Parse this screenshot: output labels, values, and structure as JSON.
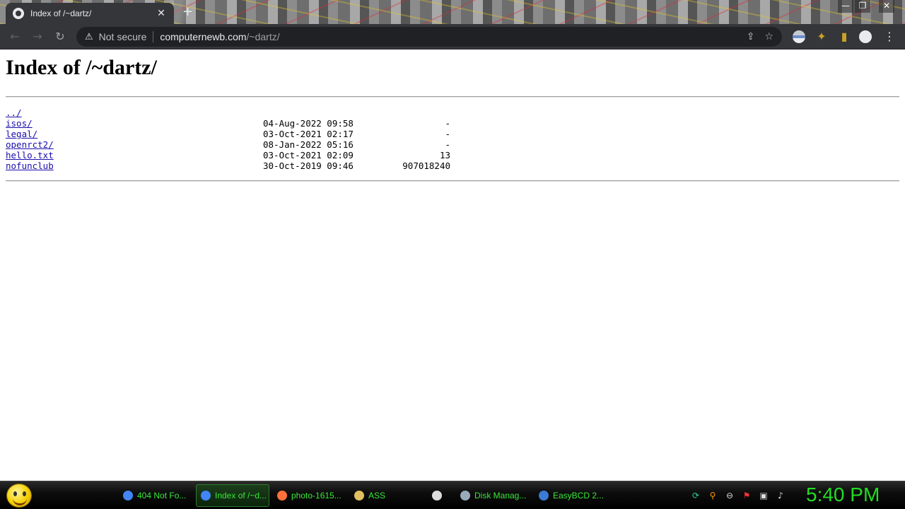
{
  "browser": {
    "tab": {
      "title": "Index of /~dartz/",
      "close": "✕"
    },
    "new_tab": "+",
    "window_controls": {
      "minimize": "—",
      "restore": "❐",
      "close": "✕"
    },
    "nav": {
      "back": "←",
      "forward": "→",
      "reload": "↻"
    },
    "address": {
      "warning_icon": "warning-icon",
      "security_label": "Not secure",
      "host": "computernewb.com",
      "path": "/~dartz/"
    }
  },
  "page": {
    "heading": "Index of /~dartz/",
    "entries": [
      {
        "name": "../",
        "date": "",
        "size": ""
      },
      {
        "name": "isos/",
        "date": "04-Aug-2022 09:58",
        "size": "-"
      },
      {
        "name": "legal/",
        "date": "03-Oct-2021 02:17",
        "size": "-"
      },
      {
        "name": "openrct2/",
        "date": "08-Jan-2022 05:16",
        "size": "-"
      },
      {
        "name": "hello.txt",
        "date": "03-Oct-2021 02:09",
        "size": "13"
      },
      {
        "name": "nofunclub",
        "date": "30-Oct-2019 09:46",
        "size": "907018240"
      }
    ]
  },
  "taskbar": {
    "tasks": [
      {
        "label": "404 Not Fo...",
        "icon": "chrome-icon"
      },
      {
        "label": "Index of /~d...",
        "icon": "chrome-icon"
      },
      {
        "label": "photo-1615...",
        "icon": "firefox-icon"
      },
      {
        "label": "ASS",
        "icon": "document-icon"
      },
      {
        "label": "",
        "icon": "7zip-icon"
      },
      {
        "label": "Disk Manag...",
        "icon": "disk-management-icon"
      },
      {
        "label": "EasyBCD 2...",
        "icon": "easybcd-icon"
      }
    ],
    "clock": "5:40 PM"
  },
  "colors": {
    "link": "#1a0dab",
    "taskbar_text": "#38e838",
    "clock": "#22dd22"
  }
}
